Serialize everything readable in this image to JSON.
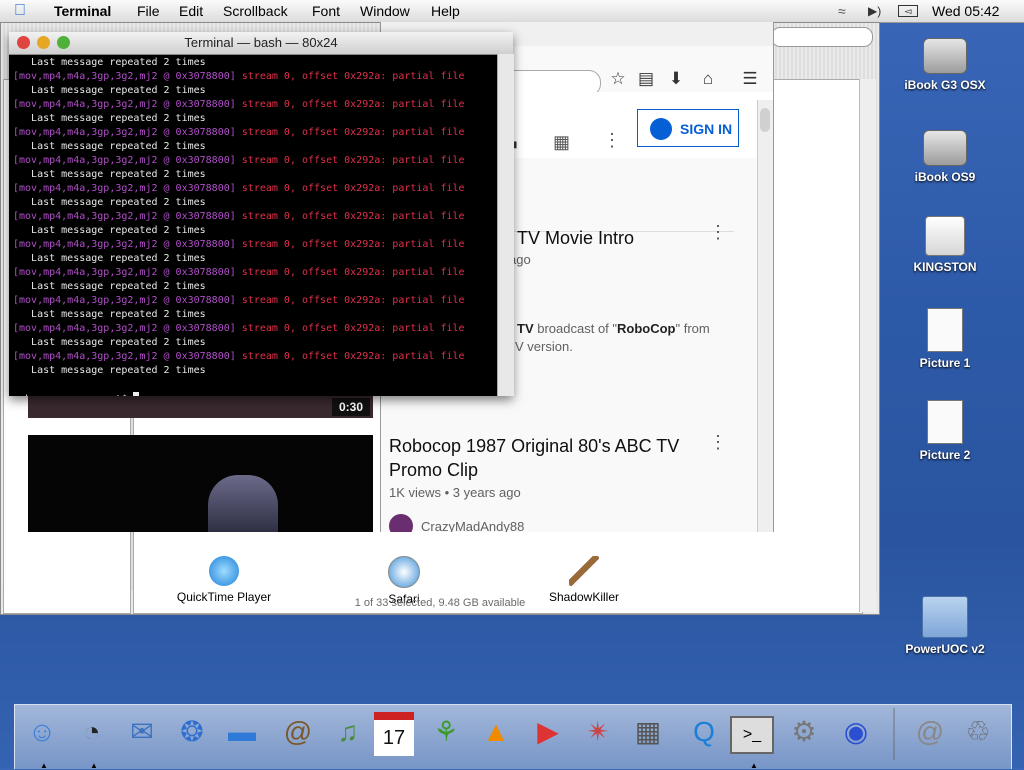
{
  "menubar": {
    "app": "Terminal",
    "items": [
      "File",
      "Edit",
      "Scrollback",
      "Font",
      "Window",
      "Help"
    ],
    "clock": "Wed 05:42"
  },
  "finder": {
    "status": "1 of 33 selected, 9.48 GB available",
    "apps": [
      {
        "label": "QuickTime Player"
      },
      {
        "label": "Safari"
      },
      {
        "label": "ShadowKiller"
      }
    ]
  },
  "browser": {
    "signin": "SIGN IN",
    "videos": [
      {
        "title": "TV Movie Intro",
        "meta": "ago",
        "desc_bold1": "TV",
        "desc_mid": " broadcast of \"",
        "desc_bold2": "RoboCop",
        "desc_end": "\" from",
        "desc_line2": "V version.",
        "duration": "0:30"
      },
      {
        "title": "Robocop 1987 Original 80's ABC TV Promo Clip",
        "meta": "1K views • 3 years ago",
        "channel": "CrazyMadAndy88"
      }
    ],
    "side_fragment": "C"
  },
  "terminal": {
    "title": "Terminal — bash — 80x24",
    "repeat_line": "   Last message repeated 2 times",
    "err_prefix": "[mov,mp4,m4a,3gp,3g2,mj2 @ 0x3078800]",
    "err_msg": " stream 0, offset 0x292a: partial file",
    "prompt": "unknown:~ argonaut$ "
  },
  "desktop": {
    "icons": [
      {
        "label": "iBook G3 OSX",
        "kind": "hd"
      },
      {
        "label": "iBook OS9",
        "kind": "hd"
      },
      {
        "label": "KINGSTON",
        "kind": "usb"
      },
      {
        "label": "Picture 1",
        "kind": "png"
      },
      {
        "label": "Picture 2",
        "kind": "png"
      },
      {
        "label": "PowerUOC v2",
        "kind": "folder"
      }
    ]
  },
  "dock": {
    "icons": [
      "finder-icon",
      "dashboard-icon",
      "mail-icon",
      "safari-icon",
      "ichat-icon",
      "address-book-icon",
      "itunes-icon",
      "ical-icon",
      "frog-icon",
      "vlc-icon",
      "video-icon",
      "photo-wheel-icon",
      "monitor-icon",
      "quicktime-icon",
      "terminal-icon",
      "preferences-icon",
      "network-icon",
      "at-icon",
      "trash-icon"
    ]
  }
}
